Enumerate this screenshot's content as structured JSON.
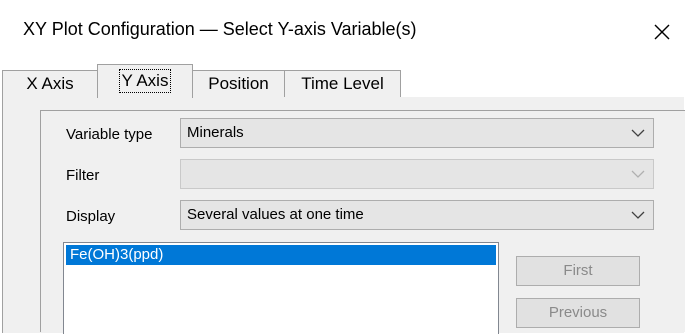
{
  "window": {
    "title": "XY Plot Configuration — Select Y-axis Variable(s)"
  },
  "tabs": [
    {
      "label": "X Axis",
      "active": false
    },
    {
      "label": "Y Axis",
      "active": true
    },
    {
      "label": "Position",
      "active": false
    },
    {
      "label": "Time Level",
      "active": false
    }
  ],
  "form": {
    "variable_type": {
      "label": "Variable type",
      "value": "Minerals"
    },
    "filter": {
      "label": "Filter",
      "value": "",
      "disabled": true
    },
    "display": {
      "label": "Display",
      "value": "Several values at one time"
    }
  },
  "list": {
    "items": [
      {
        "label": "Fe(OH)3(ppd)",
        "selected": true
      }
    ]
  },
  "buttons": {
    "first": "First",
    "previous": "Previous"
  },
  "colors": {
    "selection": "#0078d7",
    "dialog_bg": "#f0f0f0",
    "disabled_text": "#8a8a8a"
  }
}
